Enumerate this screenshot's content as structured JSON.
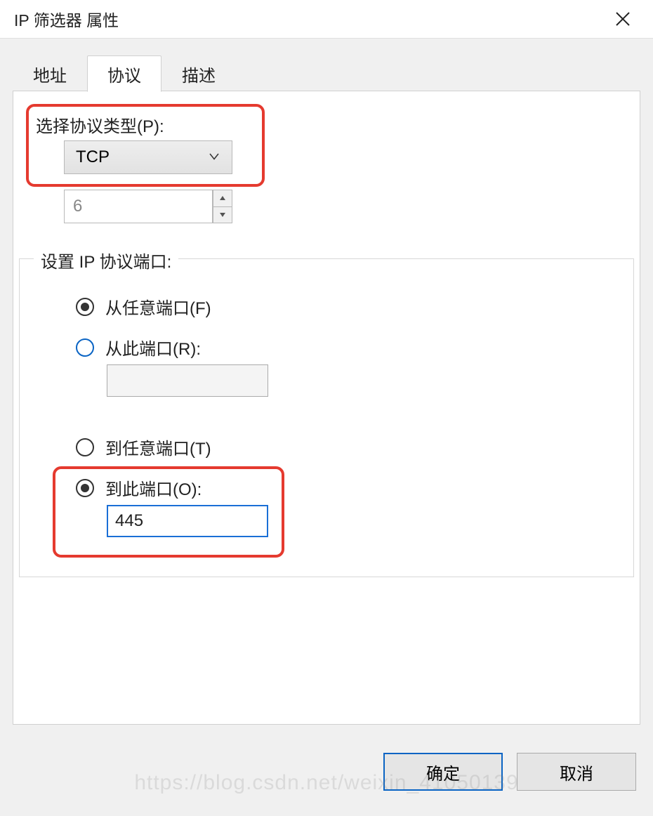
{
  "title": "IP 筛选器 属性",
  "tabs": {
    "address": "地址",
    "protocol": "协议",
    "description": "描述"
  },
  "protocol_type_label": "选择协议类型(P):",
  "protocol_type_value": "TCP",
  "protocol_number": "6",
  "group_title": "设置 IP 协议端口:",
  "radios": {
    "from_any": "从任意端口(F)",
    "from_this": "从此端口(R):",
    "to_any": "到任意端口(T)",
    "to_this": "到此端口(O):"
  },
  "from_port_value": "",
  "to_port_value": "445",
  "buttons": {
    "ok": "确定",
    "cancel": "取消"
  },
  "watermark": "https://blog.csdn.net/weixin_41050139"
}
